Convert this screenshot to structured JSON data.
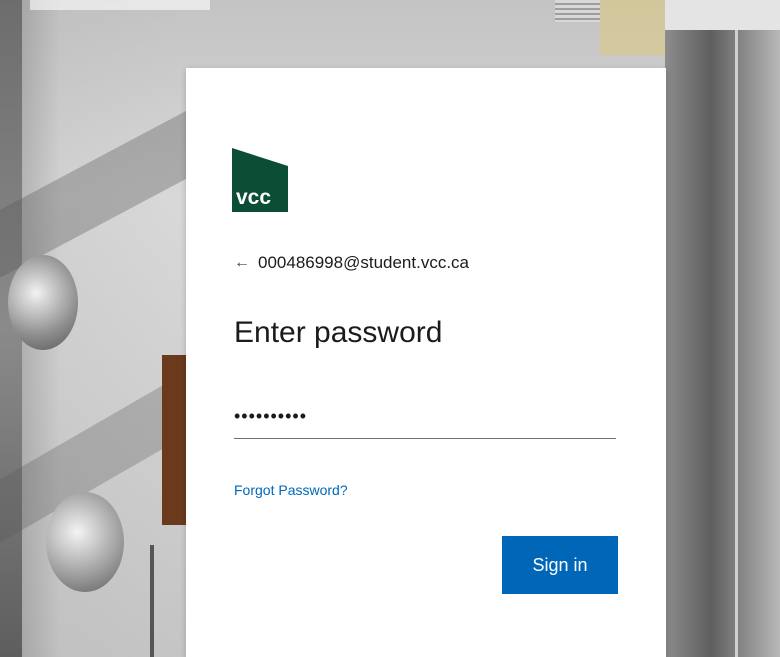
{
  "logo": {
    "text": "vcc",
    "brand_color": "#0b4d35"
  },
  "identity": {
    "back_icon": "arrow-left-icon",
    "account": "000486998@student.vcc.ca"
  },
  "title": "Enter password",
  "password": {
    "value": "••••••••••"
  },
  "links": {
    "forgot_password": "Forgot Password?"
  },
  "buttons": {
    "sign_in": "Sign in"
  },
  "colors": {
    "primary_button": "#0067b8",
    "link": "#0067b8"
  }
}
